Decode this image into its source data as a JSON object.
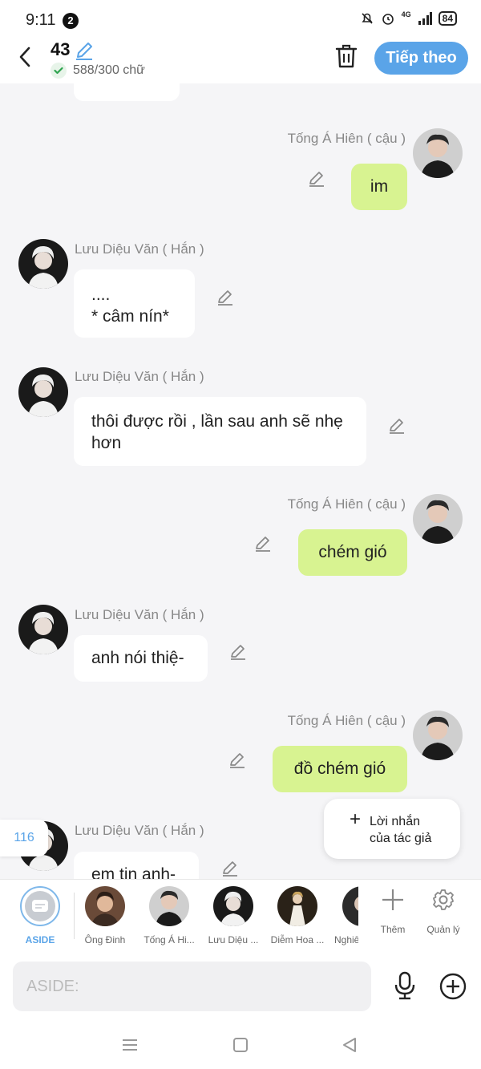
{
  "status": {
    "time": "9:11",
    "notif_count": "2",
    "network": "4G",
    "battery": "84"
  },
  "header": {
    "title": "43",
    "word_count": "588/300 chữ",
    "next_label": "Tiếp theo"
  },
  "messages": [
    {
      "side": "left",
      "name": "Lưu Diệu Văn ( Hắn )",
      "text": ""
    },
    {
      "side": "right",
      "name": "Tống Á Hiên ( cậu )",
      "text": "im"
    },
    {
      "side": "left",
      "name": "Lưu Diệu Văn ( Hắn )",
      "text": "....\n* câm nín*"
    },
    {
      "side": "left",
      "name": "Lưu Diệu Văn ( Hắn )",
      "text": "thôi được rồi , lần sau anh sẽ nhẹ hơn"
    },
    {
      "side": "right",
      "name": "Tống Á Hiên ( cậu )",
      "text": "chém gió"
    },
    {
      "side": "left",
      "name": "Lưu Diệu Văn ( Hắn )",
      "text": "anh nói thiệ-"
    },
    {
      "side": "right",
      "name": "Tống Á Hiên ( cậu )",
      "text": "đồ chém gió"
    },
    {
      "side": "left",
      "name": "Lưu Diệu Văn ( Hắn )",
      "text": "em tin anh-"
    }
  ],
  "author_note": {
    "label": "Lời nhắn của tác giả"
  },
  "side_count": "116",
  "characters": {
    "aside_label": "ASIDE",
    "items": [
      {
        "label": "Ông Đinh"
      },
      {
        "label": "Tống Á Hi..."
      },
      {
        "label": "Lưu Diệu ..."
      },
      {
        "label": "Diễm Hoa ..."
      },
      {
        "label": "Nghiê"
      }
    ],
    "add_label": "Thêm",
    "manage_label": "Quản lý"
  },
  "input": {
    "placeholder": "ASIDE:"
  },
  "colors": {
    "accent": "#5aa4e8",
    "right_bubble": "#d8f391",
    "left_bubble": "#ffffff",
    "background": "#f5f5f7"
  }
}
